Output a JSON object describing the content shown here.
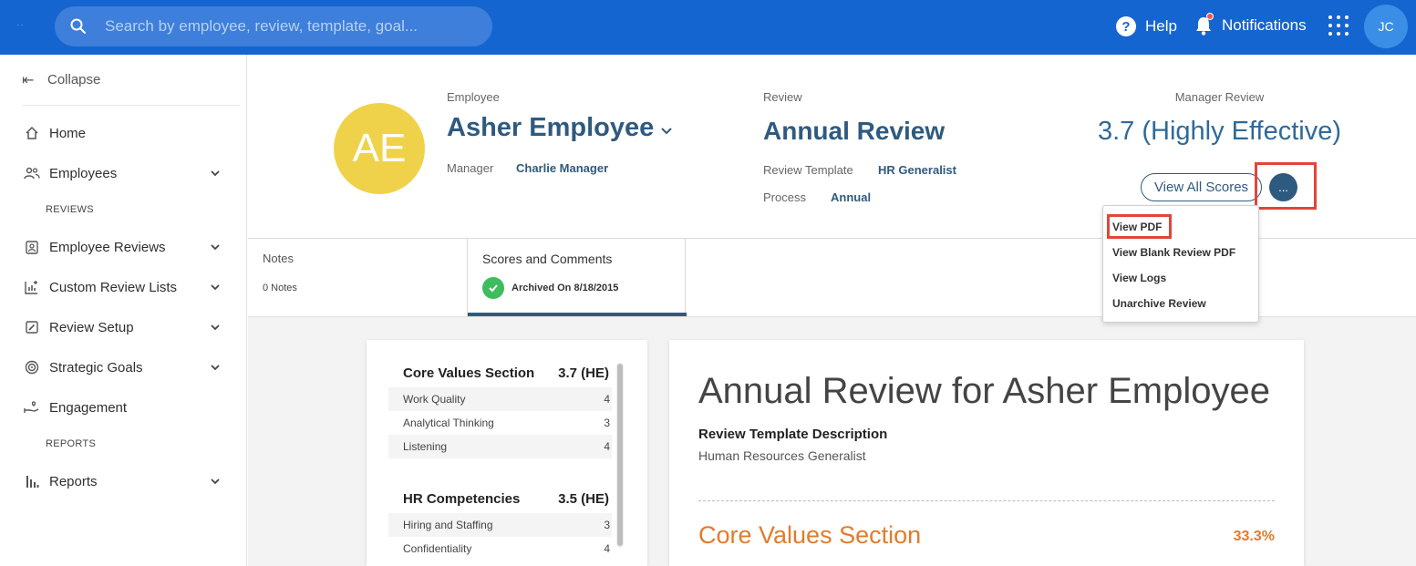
{
  "topbar": {
    "search_placeholder": "Search by employee, review, template, goal...",
    "help_label": "Help",
    "notifications_label": "Notifications",
    "user_initials": "JC",
    "color": "#1565d0"
  },
  "sidebar": {
    "collapse_label": "Collapse",
    "items": [
      {
        "label": "Home",
        "icon": "home-icon"
      },
      {
        "label": "Employees",
        "icon": "people-icon"
      },
      {
        "label": "Employee Reviews",
        "icon": "review-icon"
      },
      {
        "label": "Custom Review Lists",
        "icon": "list-icon"
      },
      {
        "label": "Review Setup",
        "icon": "edit-icon"
      },
      {
        "label": "Strategic Goals",
        "icon": "target-icon"
      },
      {
        "label": "Engagement",
        "icon": "engagement-icon"
      },
      {
        "label": "Reports",
        "icon": "chart-icon"
      }
    ],
    "sections": {
      "reviews": "REVIEWS",
      "reports": "REPORTS"
    }
  },
  "header": {
    "avatar_initials": "AE",
    "employee_label": "Employee",
    "employee_name": "Asher Employee",
    "manager_label": "Manager",
    "manager_name": "Charlie Manager",
    "review_label": "Review",
    "review_name": "Annual Review",
    "template_label": "Review Template",
    "template_name": "HR Generalist",
    "process_label": "Process",
    "process_name": "Annual",
    "manager_review_label": "Manager Review",
    "manager_review_score": "3.7 (Highly Effective)",
    "view_all_scores": "View All Scores",
    "more_button": "..."
  },
  "dropdown": {
    "items": [
      "View PDF",
      "View Blank Review PDF",
      "View Logs",
      "Unarchive Review"
    ]
  },
  "tabs": {
    "notes_title": "Notes",
    "notes_sub": "0 Notes",
    "scores_title": "Scores and Comments",
    "archived": "Archived On 8/18/2015"
  },
  "scores": {
    "sections": [
      {
        "title": "Core Values Section",
        "score": "3.7 (HE)",
        "rows": [
          {
            "name": "Work Quality",
            "value": "4"
          },
          {
            "name": "Analytical Thinking",
            "value": "3"
          },
          {
            "name": "Listening",
            "value": "4"
          }
        ]
      },
      {
        "title": "HR Competencies",
        "score": "3.5 (HE)",
        "rows": [
          {
            "name": "Hiring and Staffing",
            "value": "3"
          },
          {
            "name": "Confidentiality",
            "value": "4"
          }
        ]
      }
    ]
  },
  "review_card": {
    "title": "Annual Review for Asher Employee",
    "template_desc_label": "Review Template Description",
    "template_desc": "Human Resources Generalist",
    "section_title": "Core Values Section",
    "section_pct": "33.3%"
  }
}
